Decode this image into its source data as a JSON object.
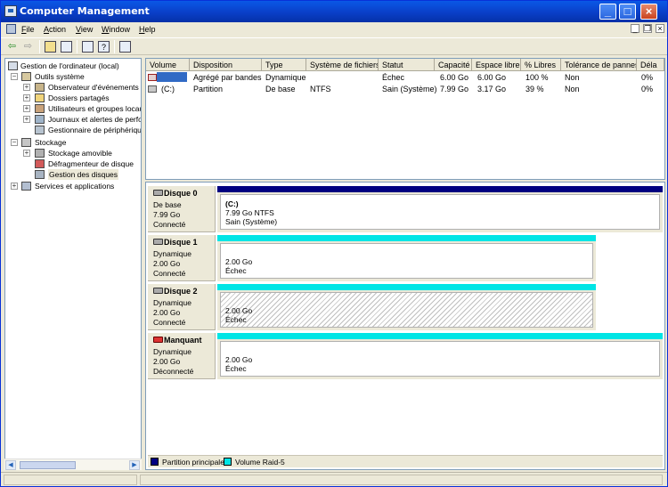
{
  "window": {
    "title": "Computer Management"
  },
  "menu": {
    "items": [
      "File",
      "Action",
      "View",
      "Window",
      "Help"
    ]
  },
  "toolbar": {
    "icons": [
      "back-arrow-icon",
      "forward-arrow-icon",
      "up-folder-icon",
      "show-hide-tree-icon",
      "properties-icon",
      "help-icon",
      "refresh-icon"
    ]
  },
  "tree": {
    "root": "Gestion de l'ordinateur (local)",
    "tools": "Outils système",
    "event_viewer": "Observateur d'événements",
    "shared_folders": "Dossiers partagés",
    "users_groups": "Utilisateurs et groupes locaux",
    "logs_alerts": "Journaux et alertes de performance",
    "device_manager": "Gestionnaire de périphériques",
    "storage": "Stockage",
    "removable": "Stockage amovible",
    "defrag": "Défragmenteur de disque",
    "disk_mgmt": "Gestion des disques",
    "services": "Services et applications"
  },
  "volumes": {
    "headers": [
      "Volume",
      "Disposition",
      "Type",
      "Système de fichiers",
      "Statut",
      "Capacité",
      "Espace libre",
      "% Libres",
      "Tolérance de pannes",
      "Déla"
    ],
    "rows": [
      {
        "volume": "",
        "disposition": "Agrégé par bandes",
        "type": "Dynamique",
        "fs": "",
        "status": "Échec",
        "capacity": "6.00 Go",
        "free": "6.00 Go",
        "pct": "100 %",
        "tolerance": "Non",
        "overhead": "0%"
      },
      {
        "volume": "(C:)",
        "disposition": "Partition",
        "type": "De base",
        "fs": "NTFS",
        "status": "Sain (Système)",
        "capacity": "7.99 Go",
        "free": "3.17 Go",
        "pct": "39 %",
        "tolerance": "Non",
        "overhead": "0%"
      }
    ]
  },
  "disks": [
    {
      "name": "Disque 0",
      "type": "De base",
      "size": "7.99 Go",
      "state": "Connecté",
      "volume_name": "(C:)",
      "volume_line1": "7.99 Go NTFS",
      "volume_line2": "Sain (Système)"
    },
    {
      "name": "Disque 1",
      "type": "Dynamique",
      "size": "2.00 Go",
      "state": "Connecté",
      "volume_line1": "2.00 Go",
      "volume_line2": "Échec"
    },
    {
      "name": "Disque 2",
      "type": "Dynamique",
      "size": "2.00 Go",
      "state": "Connecté",
      "volume_line1": "2.00 Go",
      "volume_line2": "Échec"
    },
    {
      "name": "Manquant",
      "type": "Dynamique",
      "size": "2.00 Go",
      "state": "Déconnecté",
      "volume_line1": "2.00 Go",
      "volume_line2": "Échec"
    }
  ],
  "legend": {
    "primary_partition": "Partition principale",
    "raid5": "Volume Raid-5"
  },
  "colors": {
    "primary_partition": "#000080",
    "raid5": "#00e5e5",
    "title_bar": "#0a58e6",
    "selection": "#316ac5"
  }
}
